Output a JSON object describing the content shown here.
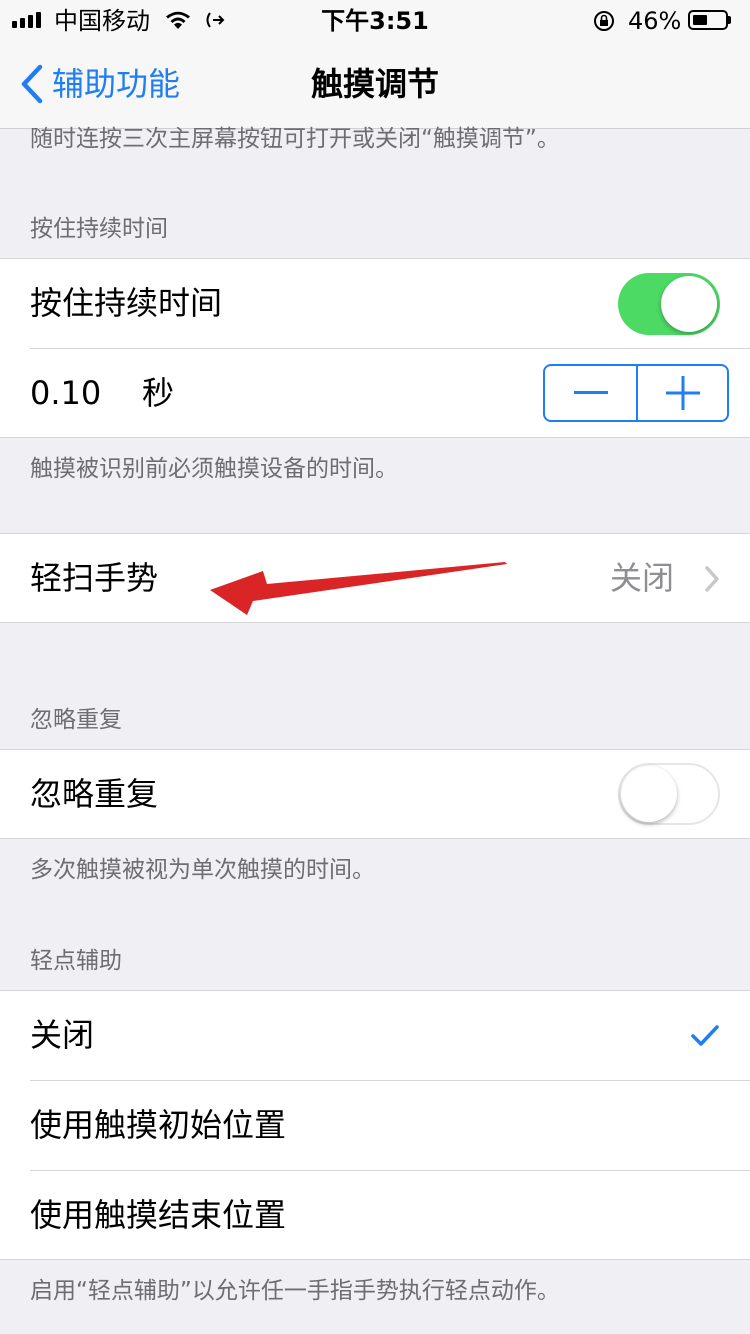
{
  "status_bar": {
    "carrier": "中国移动",
    "time": "下午3:51",
    "battery_percent": "46%",
    "battery_level": 0.46
  },
  "nav": {
    "back_label": "辅助功能",
    "title": "触摸调节"
  },
  "sections": {
    "top_note": "随时连按三次主屏幕按钮可打开或关闭“触摸调节”。",
    "hold_duration": {
      "header": "按住持续时间",
      "toggle_label": "按住持续时间",
      "toggle_on": true,
      "value": "0.10",
      "unit": "秒",
      "note": "触摸被识别前必须触摸设备的时间。"
    },
    "swipe_gestures": {
      "label": "轻扫手势",
      "value": "关闭"
    },
    "ignore_repeat": {
      "header": "忽略重复",
      "toggle_label": "忽略重复",
      "toggle_on": false,
      "note": "多次触摸被视为单次触摸的时间。"
    },
    "tap_assistance": {
      "header": "轻点辅助",
      "options": [
        "关闭",
        "使用触摸初始位置",
        "使用触摸结束位置"
      ],
      "selected_index": 0,
      "note": "启用“轻点辅助”以允许任一手指手势执行轻点动作。"
    }
  },
  "colors": {
    "accent": "#1e7ef2",
    "switch_on": "#4cd964",
    "annotation_arrow": "#d92525"
  }
}
